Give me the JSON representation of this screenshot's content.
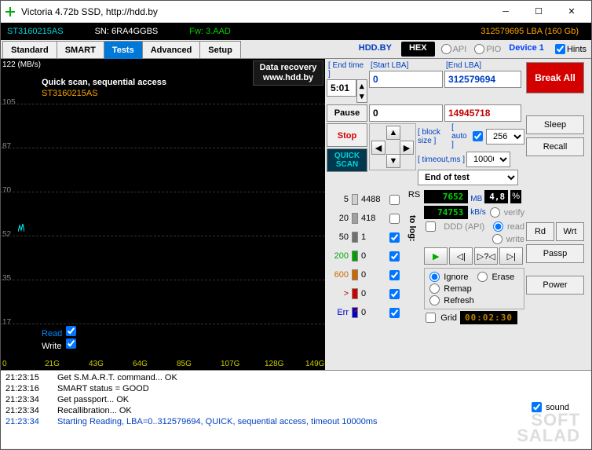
{
  "title": "Victoria 4.72b SSD, http://hdd.by",
  "info": {
    "model": "ST3160215AS",
    "sn": "SN: 6RA4GGBS",
    "fw": "Fw: 3.AAD",
    "lba": "312579695 LBA (160 Gb)"
  },
  "tabs": {
    "t0": "Standard",
    "t1": "SMART",
    "t2": "Tests",
    "t3": "Advanced",
    "t4": "Setup"
  },
  "hdd_label": "HDD.BY",
  "hex": "HEX",
  "api": "API",
  "pio": "PIO",
  "device": "Device 1",
  "hints": "Hints",
  "graph": {
    "units": "122 (MB/s)",
    "title": "Quick scan, sequential access",
    "model": "ST3160215AS",
    "recovery_l1": "Data recovery",
    "recovery_l2": "www.hdd.by",
    "y": {
      "y1": "105",
      "y2": "87",
      "y3": "70",
      "y4": "52",
      "y5": "35",
      "y6": "17"
    },
    "x": {
      "x0": "0",
      "x1": "21G",
      "x2": "43G",
      "x3": "64G",
      "x4": "85G",
      "x5": "107G",
      "x6": "128G",
      "x7": "149G"
    },
    "read": "Read",
    "write": "Write"
  },
  "ctrl": {
    "end_time_lbl": "[ End time ]",
    "end_time": "5:01",
    "start_lbl": "[Start LBA]",
    "start": "0",
    "end_lbl": "[End LBA]",
    "end": "312579694",
    "start2": "0",
    "cur": "14945718",
    "pause": "Pause",
    "stop": "Stop",
    "quick": "QUICK SCAN",
    "break": "Break All",
    "block_lbl": "[ block size ]",
    "auto_lbl": "[ auto ]",
    "block": "256",
    "timeout_lbl": "[ timeout,ms ]",
    "timeout": "10000",
    "endtest": "End of test",
    "sleep": "Sleep",
    "recall": "Recall",
    "rd": "Rd",
    "wrt": "Wrt",
    "passp": "Passp",
    "power": "Power"
  },
  "hist": {
    "rs": "RS",
    "tolog": "to log:",
    "h1n": "5",
    "h1v": "4488",
    "h2n": "20",
    "h2v": "418",
    "h3n": "50",
    "h3v": "1",
    "h4n": "200",
    "h4v": "0",
    "h5n": "600",
    "h5v": "0",
    "h6n": ">",
    "h6v": "0",
    "errn": "Err",
    "errv": "0"
  },
  "stats": {
    "mb": "7652",
    "mb_u": "MB",
    "pct": "4,8",
    "pct_u": "%",
    "kbs": "74753",
    "kbs_u": "kB/s",
    "ddd": "DDD (API)"
  },
  "verify": "verify",
  "read_opt": "read",
  "write_opt": "write",
  "modes": {
    "ignore": "Ignore",
    "erase": "Erase",
    "remap": "Remap",
    "refresh": "Refresh"
  },
  "grid": "Grid",
  "timer": "00:02:30",
  "sound": "sound",
  "log": [
    {
      "ts": "21:23:15",
      "msg": "Get S.M.A.R.T. command... OK"
    },
    {
      "ts": "21:23:16",
      "msg": "SMART status = GOOD"
    },
    {
      "ts": "21:23:34",
      "msg": "Get passport... OK"
    },
    {
      "ts": "21:23:34",
      "msg": "Recallibration... OK"
    },
    {
      "ts": "21:23:34",
      "msg": "Starting Reading, LBA=0..312579694, QUICK, sequential access, timeout 10000ms",
      "c": "blue"
    }
  ]
}
